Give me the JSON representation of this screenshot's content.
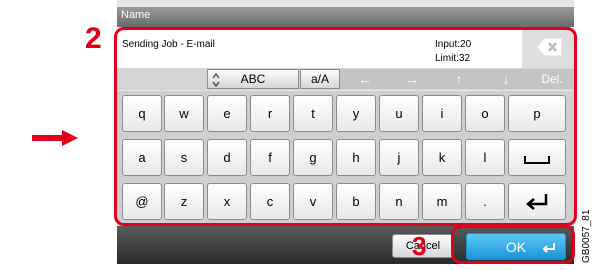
{
  "header": {
    "title": "Name"
  },
  "input": {
    "value": "Sending Job - E-mail",
    "count_line1": "Input:20",
    "count_line2": "Limit:32"
  },
  "controls": {
    "abc_label": "ABC",
    "case_label": "a/A",
    "nav_left": "←",
    "nav_right": "→",
    "nav_up": "↑",
    "nav_down": "↓",
    "del_label": "Del."
  },
  "keyboard": {
    "row1": [
      "q",
      "w",
      "e",
      "r",
      "t",
      "y",
      "u",
      "i",
      "o",
      "p"
    ],
    "row2": [
      "a",
      "s",
      "d",
      "f",
      "g",
      "h",
      "j",
      "k",
      "l"
    ],
    "row3": [
      "@",
      "z",
      "x",
      "c",
      "v",
      "b",
      "n",
      "m",
      "."
    ]
  },
  "footer": {
    "cancel_label": "Cancel",
    "ok_label": "OK"
  },
  "annotations": {
    "step2": "2",
    "step3": "3",
    "code": "GB0057_81"
  },
  "colors": {
    "highlight": "#e0001b",
    "ok_button": "#1b96d8",
    "arrow": "#e0001b"
  },
  "icons": [
    "backspace-icon",
    "spinner-icon",
    "space-icon",
    "enter-icon",
    "pointer-arrow"
  ]
}
